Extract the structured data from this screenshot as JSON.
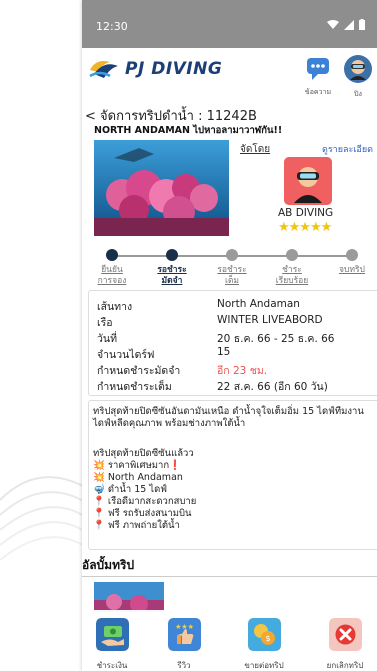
{
  "status_bar": {
    "time": "12:30"
  },
  "app": {
    "brand": "PJ DIVING",
    "message_label": "ข้อความ",
    "profile_label": "ปิง"
  },
  "back_label": "< จัดการทริปดำน้ำ : 11242B",
  "trip": {
    "title": "NORTH ANDAMAN ไปหาอลามาวาฬกัน!!",
    "organizer_label": "จัดโดย",
    "detail_link": "ดูรายละเอียด",
    "organizer_name": "AB DIVING",
    "rating_stars": "★★★★★",
    "rating": 5
  },
  "steps": [
    {
      "label1": "ยืนยัน",
      "label2": "การจอง",
      "state": "done"
    },
    {
      "label1": "รอชำระ",
      "label2": "มัดจำ",
      "state": "active"
    },
    {
      "label1": "รอชำระ",
      "label2": "เต็ม",
      "state": "pending"
    },
    {
      "label1": "ชำระ",
      "label2": "เรียบร้อย",
      "state": "pending"
    },
    {
      "label1": "จบทริป",
      "label2": "",
      "state": "pending"
    }
  ],
  "info": [
    {
      "label": "เส้นทาง",
      "value": "North Andaman"
    },
    {
      "label": "เรือ",
      "value": "WINTER LIVEABORD"
    },
    {
      "label": "วันที่",
      "value": "20 ธ.ค. 66 - 25 ธ.ค. 66"
    },
    {
      "label": "จำนวนไดร์ฟ",
      "value": "15"
    },
    {
      "label": "กำหนดชำระมัดจำ",
      "value": "อีก 23 ชม."
    },
    {
      "label": "กำหนดชำระเต็ม",
      "value": "22 ส.ค. 66  (อีก 60 วัน)"
    }
  ],
  "description": {
    "intro": "ทริปสุดท้ายปิดซีซันอันดามันเหนือ ดำน้ำจุใจเต็มอิ่ม 15 ไดฟ์ทีมงานไดฟ์หลีดคุณภาพ พร้อมช่างภาพใต้น้ำ",
    "highlight_title": "ทริปสุดท้ายปิดซีซันแล้วว",
    "bullets": [
      "💥 ราคาพิเศษมาก❗",
      "💥 North Andaman",
      "🤿 ดำน้ำ 15 ไดฟ์",
      "📍 เรือดีมากสะดวกสบาย",
      "📍 ฟรี รถรับส่งสนามบิน",
      "📍 ฟรี ภาพถ่ายใต้น้ำ"
    ]
  },
  "album_title": "อัลบั้มทริป",
  "bottom_nav": [
    {
      "label": "ชำระเงิน",
      "color": "#2f6fb5"
    },
    {
      "label": "รีวิว",
      "color": "#3f86d8"
    },
    {
      "label": "ขายต่อทริป",
      "color": "#45aadd"
    },
    {
      "label": "ยกเลิกทริป",
      "color": "#f3c6bf"
    }
  ],
  "colors": {
    "primary": "#1a2e4a",
    "accent_red": "#f05050",
    "link": "#3060c0",
    "star": "#f1c40f"
  }
}
